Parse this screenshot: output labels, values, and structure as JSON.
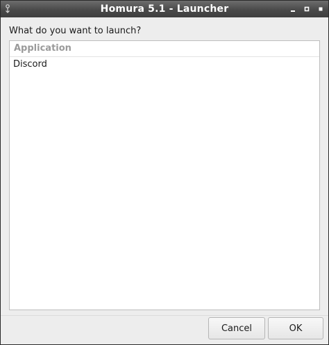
{
  "window": {
    "title": "Homura 5.1 - Launcher"
  },
  "dialog": {
    "prompt": "What do you want to launch?",
    "list": {
      "header": "Application",
      "items": [
        "Discord"
      ]
    }
  },
  "buttons": {
    "cancel_label": "Cancel",
    "ok_label": "OK"
  },
  "icons": {
    "window_menu": "window-menu-icon",
    "minimize": "minimize-icon",
    "maximize": "maximize-icon",
    "close": "close-icon"
  },
  "colors": {
    "titlebar": "#4a4a4a",
    "title_text": "#ffffff",
    "header_text": "#9a9a9a"
  }
}
